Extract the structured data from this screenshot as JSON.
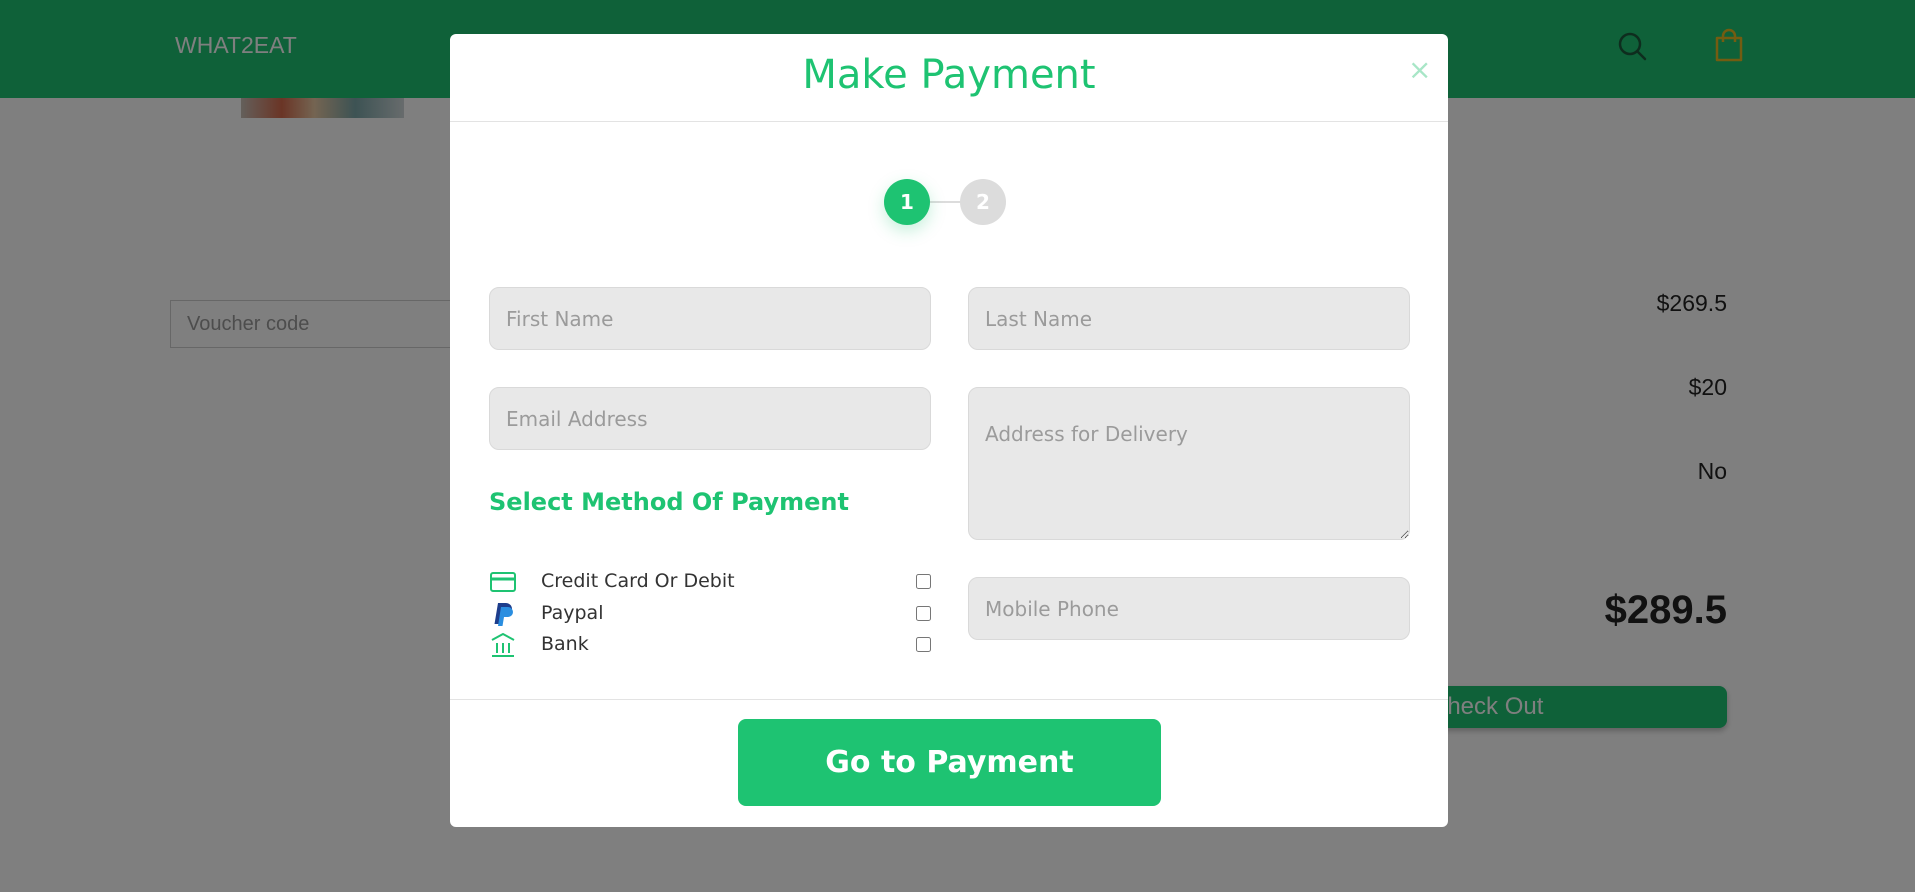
{
  "navbar": {
    "brand": "WHAT2EAT",
    "icons": [
      "search-icon",
      "shopping-bag-icon"
    ],
    "color": "#1ec372"
  },
  "cart": {
    "voucher_placeholder": "Voucher code",
    "subtotal": "$269.5",
    "delivery_fee": "$20",
    "voucher_applied": "No",
    "total": "$289.5",
    "checkout_label": "Check Out"
  },
  "modal": {
    "title": "Make Payment",
    "close_symbol": "×",
    "steps": [
      {
        "label": "1",
        "active": true
      },
      {
        "label": "2",
        "active": false
      }
    ],
    "fields": {
      "first_name_placeholder": "First Name",
      "last_name_placeholder": "Last Name",
      "email_placeholder": "Email Address",
      "address_placeholder": "Address for Delivery",
      "phone_placeholder": "Mobile Phone"
    },
    "payment_section_title": "Select Method Of Payment",
    "payment_methods": [
      {
        "label": "Credit Card Or Debit",
        "icon": "credit-card-icon",
        "checked": false
      },
      {
        "label": "Paypal",
        "icon": "paypal-icon",
        "checked": false
      },
      {
        "label": "Bank",
        "icon": "bank-icon",
        "checked": false
      }
    ],
    "submit_label": "Go to Payment"
  },
  "colors": {
    "accent": "#1ec372",
    "step_inactive": "#dcdcdc",
    "field_bg": "#e8e8e8",
    "bag_icon": "#e8b823"
  }
}
